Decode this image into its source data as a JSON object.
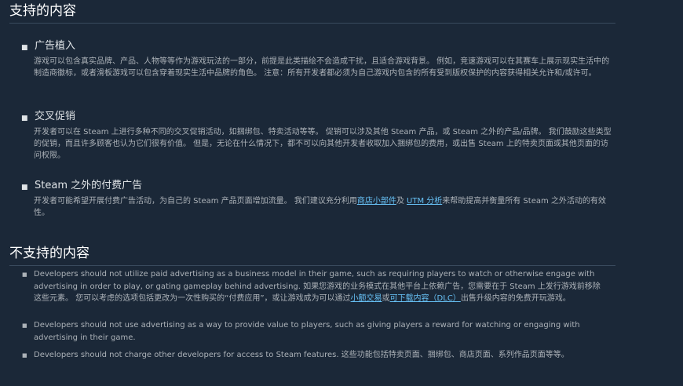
{
  "supported": {
    "title": "支持的内容",
    "items": [
      {
        "heading": "广告植入",
        "body": "游戏可以包含真实品牌、产品、人物等等作为游戏玩法的一部分，前提是此类描绘不会造成干扰，且适合游戏背景。 例如，竞速游戏可以在其赛车上展示现实生活中的制造商徽标，或者滑板游戏可以包含穿着现实生活中品牌的角色。 注意：所有开发者都必须为自己游戏内包含的所有受到版权保护的内容获得相关允许和/或许可。"
      },
      {
        "heading": "交叉促销",
        "body": "开发者可以在 Steam 上进行多种不同的交叉促销活动，如捆绑包、特卖活动等等。 促销可以涉及其他 Steam 产品，或 Steam 之外的产品/品牌。 我们鼓励这些类型的促销，而且许多顾客也认为它们很有价值。 但是，无论在什么情况下，都不可以向其他开发者收取加入捆绑包的费用，或出售 Steam 上的特卖页面或其他页面的访问权限。"
      },
      {
        "heading": "Steam 之外的付费广告",
        "body_before": "开发者可能希望开展付费广告活动，为自己的 Steam 产品页面增加流量。 我们建议充分利用",
        "link1": "商店小部件",
        "body_mid": "及 ",
        "link2": "UTM 分析",
        "body_after": "来帮助提高并衡量所有 Steam 之外活动的有效性。"
      }
    ]
  },
  "unsupported": {
    "title": "不支持的内容",
    "items": [
      {
        "text_before": "Developers should not utilize paid advertising as a business model in their game, such as requiring players to watch or otherwise engage with advertising in order to play, or gating gameplay behind advertising. 如果您游戏的业务模式在其他平台上依赖广告，您需要在于 Steam 上发行游戏前移除这些元素。 您可以考虑的选项包括更改为一次性购买的“付费应用”，或让游戏成为可以通过",
        "link1": "小额交易",
        "text_mid": "或",
        "link2": "可下载内容（DLC）",
        "text_after": "出售升级内容的免费开玩游戏。"
      },
      {
        "text": "Developers should not use advertising as a way to provide value to players, such as giving players a reward for watching or engaging with advertising in their game."
      },
      {
        "text": "Developers should not charge other developers for access to Steam features. 这些功能包括特卖页面、捆绑包、商店页面、系列作品页面等等。"
      }
    ]
  }
}
